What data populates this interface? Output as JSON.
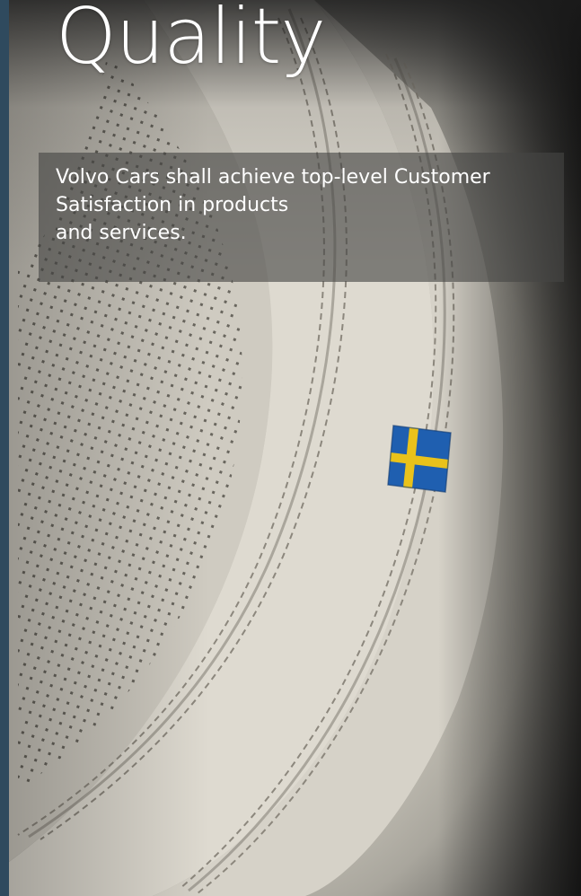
{
  "slide": {
    "title": "Quality",
    "caption_lines": [
      "Volvo Cars shall achieve top-level Customer",
      "Satisfaction in products",
      "and services."
    ]
  },
  "colors": {
    "accent_strip": "#2f4a5e",
    "flag_blue": "#1f5fb0",
    "flag_yellow": "#e9c21b",
    "caption_overlay": "rgba(70,70,68,0.62)"
  },
  "icons": [
    "swedish-flag-tag-icon"
  ]
}
